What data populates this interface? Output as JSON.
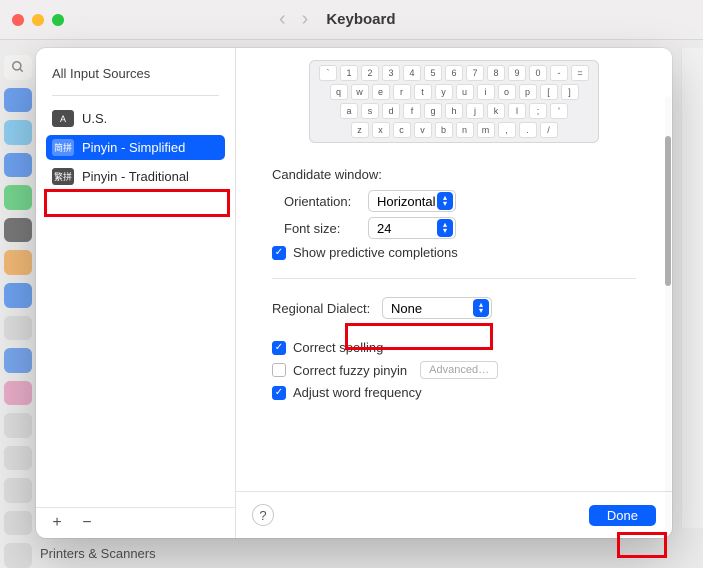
{
  "header": {
    "title": "Keyboard"
  },
  "underFooter": "Printers & Scanners",
  "sidebar": {
    "title": "All Input Sources",
    "sources": [
      {
        "badge": "A",
        "label": "U.S."
      },
      {
        "badge": "简拼",
        "label": "Pinyin - Simplified"
      },
      {
        "badge": "繁拼",
        "label": "Pinyin - Traditional"
      }
    ],
    "addLabel": "+",
    "removeLabel": "−"
  },
  "keyboard": {
    "row1": [
      "`",
      "1",
      "2",
      "3",
      "4",
      "5",
      "6",
      "7",
      "8",
      "9",
      "0",
      "-",
      "="
    ],
    "row2": [
      "q",
      "w",
      "e",
      "r",
      "t",
      "y",
      "u",
      "i",
      "o",
      "p",
      "[",
      "]"
    ],
    "row3": [
      "a",
      "s",
      "d",
      "f",
      "g",
      "h",
      "j",
      "k",
      "l",
      ";",
      "'"
    ],
    "row4": [
      "z",
      "x",
      "c",
      "v",
      "b",
      "n",
      "m",
      ",",
      ".",
      "/"
    ]
  },
  "candidate": {
    "sectionLabel": "Candidate window:",
    "orientation": {
      "label": "Orientation:",
      "value": "Horizontal"
    },
    "fontSize": {
      "label": "Font size:",
      "value": "24"
    },
    "showPredictive": {
      "label": "Show predictive completions",
      "checked": true
    }
  },
  "regionalDialect": {
    "label": "Regional Dialect:",
    "value": "None"
  },
  "corrections": {
    "spelling": {
      "label": "Correct spelling",
      "checked": true
    },
    "fuzzy": {
      "label": "Correct fuzzy pinyin",
      "checked": false,
      "advanced": "Advanced…"
    },
    "frequency": {
      "label": "Adjust word frequency",
      "checked": true
    }
  },
  "footer": {
    "help": "?",
    "done": "Done"
  }
}
